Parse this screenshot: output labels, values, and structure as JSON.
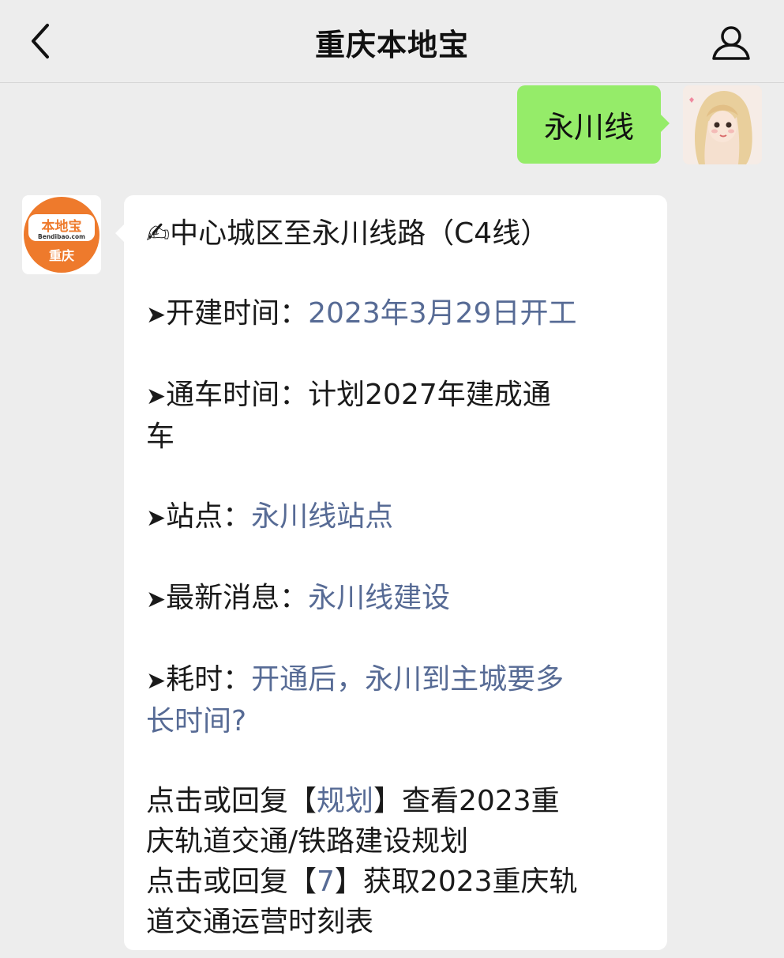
{
  "header": {
    "title": "重庆本地宝",
    "back_icon": "chevron-left-icon",
    "profile_icon": "person-icon"
  },
  "outgoing_message": {
    "text": "永川线",
    "bubble_color": "#95ec69"
  },
  "bot_avatar": {
    "logo_text": "本地宝",
    "domain_text": "Bendibao.com",
    "city_text": "重庆",
    "brand_color": "#ee7a2c"
  },
  "incoming_message": {
    "heading_icon": "✍",
    "heading": "中心城区至永川线路（C4线）",
    "arrow": "➤",
    "start_label": "开建时间：",
    "start_value": "2023年3月29日开工",
    "open_label": "通车时间：",
    "open_value_1": "计划2027年建成通",
    "open_value_2": "车",
    "stations_label": "站点：",
    "stations_link": "永川线站点",
    "news_label": "最新消息：",
    "news_link": "永川线建设",
    "duration_label": "耗时：",
    "duration_link_1": "开通后，永川到主城要多",
    "duration_link_2": "长时间?",
    "cta1_prefix": "点击或回复【",
    "cta1_link": "规划",
    "cta1_suffix": "】查看2023重",
    "cta1_line2": "庆轨道交通/铁路建设规划",
    "cta2_prefix": "点击或回复【",
    "cta2_link": "7",
    "cta2_suffix": "】获取2023重庆轨",
    "cta2_line2": "道交通运营时刻表",
    "link_color": "#576b95"
  }
}
